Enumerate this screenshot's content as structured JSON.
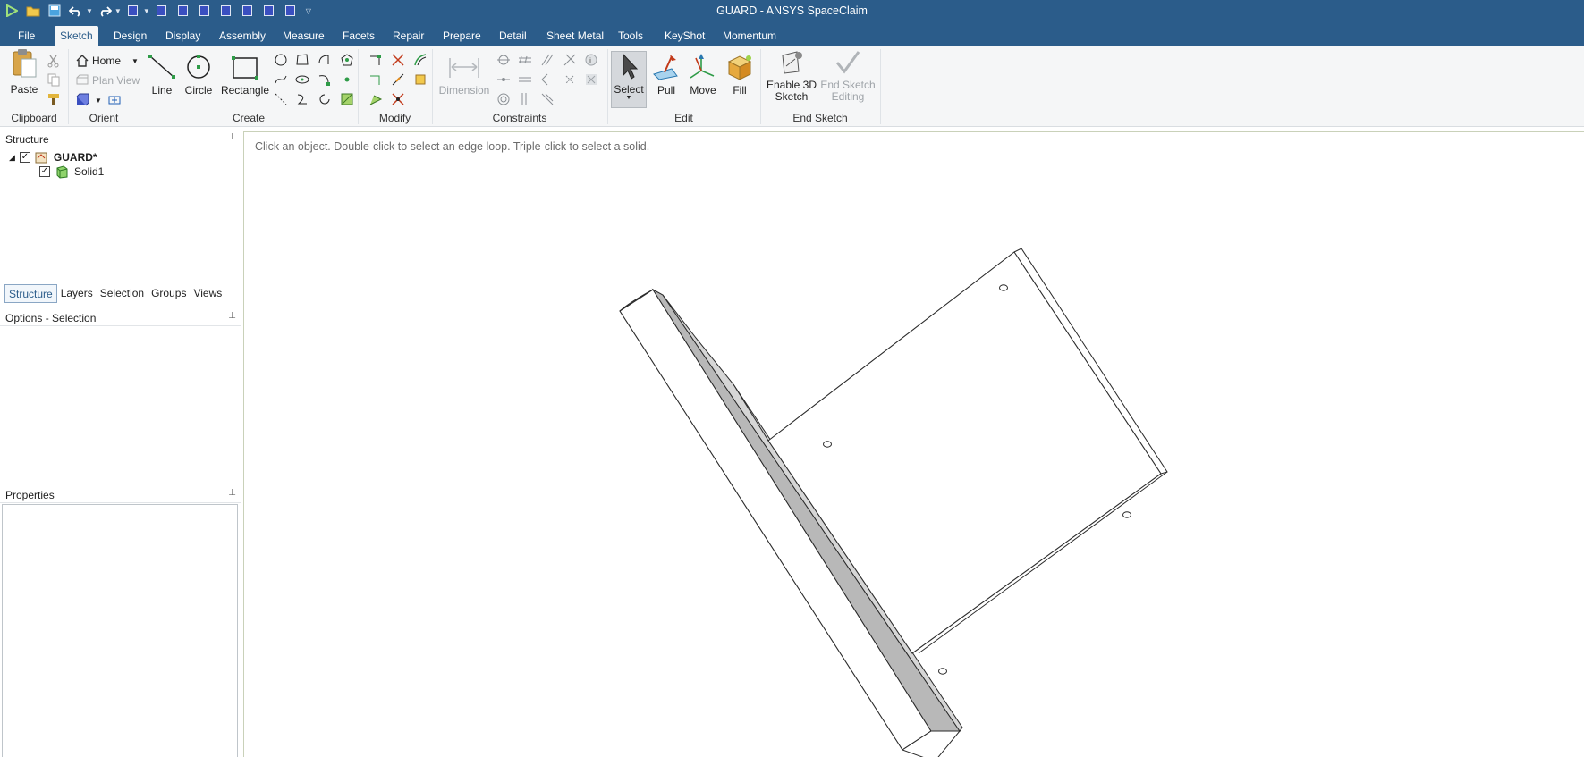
{
  "window": {
    "title": "GUARD - ANSYS SpaceClaim"
  },
  "menu": {
    "tabs": [
      "File",
      "Sketch",
      "Design",
      "Display",
      "Assembly",
      "Measure",
      "Facets",
      "Repair",
      "Prepare",
      "Detail",
      "Sheet Metal",
      "Tools",
      "KeyShot",
      "Momentum"
    ],
    "active": "Sketch"
  },
  "ribbon": {
    "clipboard": {
      "label": "Clipboard",
      "paste": "Paste"
    },
    "orient": {
      "label": "Orient",
      "home": "Home",
      "plan_view": "Plan View"
    },
    "create": {
      "label": "Create",
      "line": "Line",
      "circle": "Circle",
      "rectangle": "Rectangle"
    },
    "modify": {
      "label": "Modify"
    },
    "constraints": {
      "label": "Constraints",
      "dimension": "Dimension"
    },
    "edit": {
      "label": "Edit",
      "select": "Select",
      "pull": "Pull",
      "move": "Move",
      "fill": "Fill"
    },
    "end_sketch": {
      "label": "End Sketch",
      "enable_3d_line1": "Enable 3D",
      "enable_3d_line2": "Sketch",
      "end_editing_line1": "End Sketch",
      "end_editing_line2": "Editing"
    }
  },
  "structure_panel": {
    "title": "Structure",
    "tree": [
      {
        "label": "GUARD*",
        "checked": true,
        "icon": "assembly-icon"
      },
      {
        "label": "Solid1",
        "checked": true,
        "icon": "solid-body-icon"
      }
    ]
  },
  "panel_tabs": [
    "Structure",
    "Layers",
    "Selection",
    "Groups",
    "Views"
  ],
  "options_panel": {
    "title": "Options - Selection"
  },
  "properties_panel": {
    "title": "Properties"
  },
  "viewport": {
    "hint": "Click an object. Double-click to select an edge loop. Triple-click to select a solid."
  },
  "colors": {
    "titlebar": "#2b5c8a",
    "ribbon": "#f5f6f7",
    "accent": "#2b5c8a"
  }
}
